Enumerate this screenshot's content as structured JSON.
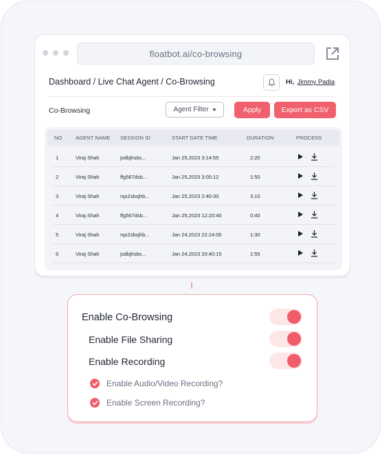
{
  "browser": {
    "url": "floatbot.ai/co-browsing"
  },
  "header": {
    "breadcrumb": "Dashboard / Live Chat Agent / Co-Browsing",
    "greeting": "Hi,",
    "user_name": "Jimmy Padia"
  },
  "toolbar": {
    "section_title": "Co-Browsing",
    "agent_filter_label": "Agent Filter",
    "apply_label": "Apply",
    "export_label": "Export as CSV"
  },
  "table": {
    "columns": [
      "NO",
      "AGENT NAME",
      "SESSION ID",
      "START DATE TIME",
      "DURATION",
      "PROCESS"
    ],
    "rows": [
      {
        "no": "1",
        "agent": "Viraj Shah",
        "session": "jsdbjhsbs...",
        "start": "Jan 25,2023 3:14:55",
        "duration": "2:20"
      },
      {
        "no": "2",
        "agent": "Viraj Shah",
        "session": "ffg567dsb...",
        "start": "Jan 25,2023 3:00:12",
        "duration": "1:50"
      },
      {
        "no": "3",
        "agent": "Viraj Shah",
        "session": "rqx2sbsjhb...",
        "start": "Jan 25,2023 2:40:30",
        "duration": "3:10"
      },
      {
        "no": "4",
        "agent": "Viraj Shah",
        "session": "ffg567dsb...",
        "start": "Jan 25,2023 12:20:40",
        "duration": "0:40"
      },
      {
        "no": "5",
        "agent": "Viraj Shah",
        "session": "rqx2sbsjhb...",
        "start": "Jan 24,2023 22:24:05",
        "duration": "1:30"
      },
      {
        "no": "6",
        "agent": "Viraj Shah",
        "session": "jsdbjhsbs...",
        "start": "Jan 24,2023 20:40:15",
        "duration": "1:55"
      }
    ],
    "row_icons": [
      "play-icon",
      "download-icon"
    ]
  },
  "settings": {
    "enable_cobrowsing": {
      "label": "Enable Co-Browsing",
      "enabled": true
    },
    "enable_file_sharing": {
      "label": "Enable File Sharing",
      "enabled": true
    },
    "enable_recording": {
      "label": "Enable Recording",
      "enabled": true
    },
    "audio_video_recording": {
      "label": "Enable Audio/Video Recording?",
      "checked": true
    },
    "screen_recording": {
      "label": "Enable Screen Recording?",
      "checked": true
    }
  },
  "colors": {
    "accent": "#f05c6a",
    "toggle_track": "#fde6e8",
    "background": "#f5f6fa"
  }
}
